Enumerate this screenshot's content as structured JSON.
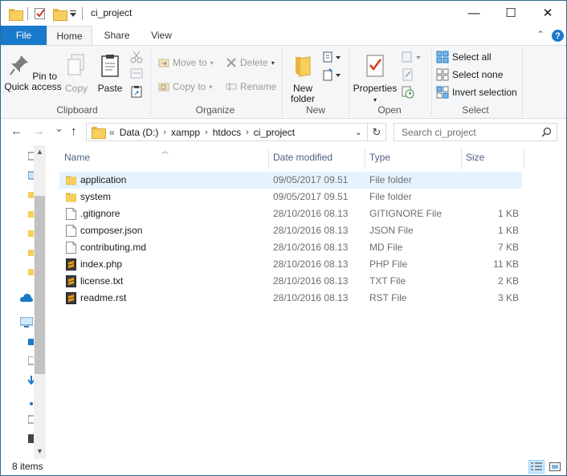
{
  "window": {
    "title": "ci_project",
    "controls": {
      "minimize": "—",
      "maximize": "☐",
      "close": "✕"
    }
  },
  "tabs": {
    "file": "File",
    "home": "Home",
    "share": "Share",
    "view": "View",
    "expand_glyph": "⌃",
    "help_glyph": "?"
  },
  "ribbon": {
    "clipboard": {
      "label": "Clipboard",
      "pin": "Pin to Quick access",
      "copy": "Copy",
      "paste": "Paste"
    },
    "organize": {
      "label": "Organize",
      "move_to": "Move to",
      "copy_to": "Copy to",
      "delete": "Delete",
      "rename": "Rename"
    },
    "new": {
      "label": "New",
      "new_folder": "New folder"
    },
    "open": {
      "label": "Open",
      "properties": "Properties"
    },
    "select": {
      "label": "Select",
      "select_all": "Select all",
      "select_none": "Select none",
      "invert_selection": "Invert selection"
    }
  },
  "navigation": {
    "back": "←",
    "forward": "→",
    "recent": "⌄",
    "up": "↑",
    "overflow": "«",
    "breadcrumb": [
      "Data (D:)",
      "xampp",
      "htdocs",
      "ci_project"
    ],
    "separator": "›",
    "refresh": "↻",
    "search_placeholder": "Search ci_project"
  },
  "columns": {
    "name": "Name",
    "date_modified": "Date modified",
    "type": "Type",
    "size": "Size"
  },
  "files": [
    {
      "name": "application",
      "date": "09/05/2017 09.51",
      "type": "File folder",
      "size": "",
      "icon": "folder-icon",
      "selected": true
    },
    {
      "name": "system",
      "date": "09/05/2017 09.51",
      "type": "File folder",
      "size": "",
      "icon": "folder-icon",
      "selected": false
    },
    {
      "name": ".gitignore",
      "date": "28/10/2016 08.13",
      "type": "GITIGNORE File",
      "size": "1 KB",
      "icon": "file-icon",
      "selected": false
    },
    {
      "name": "composer.json",
      "date": "28/10/2016 08.13",
      "type": "JSON File",
      "size": "1 KB",
      "icon": "file-icon",
      "selected": false
    },
    {
      "name": "contributing.md",
      "date": "28/10/2016 08.13",
      "type": "MD File",
      "size": "7 KB",
      "icon": "file-icon",
      "selected": false
    },
    {
      "name": "index.php",
      "date": "28/10/2016 08.13",
      "type": "PHP File",
      "size": "11 KB",
      "icon": "sublime-file-icon",
      "selected": false
    },
    {
      "name": "license.txt",
      "date": "28/10/2016 08.13",
      "type": "TXT File",
      "size": "2 KB",
      "icon": "sublime-file-icon",
      "selected": false
    },
    {
      "name": "readme.rst",
      "date": "28/10/2016 08.13",
      "type": "RST File",
      "size": "3 KB",
      "icon": "sublime-file-icon",
      "selected": false
    }
  ],
  "status": {
    "item_count": "8 items"
  },
  "colors": {
    "accent": "#1979ca",
    "selection": "#e5f3ff",
    "folder": "#f7cf5c",
    "header_text": "#4d6082"
  }
}
